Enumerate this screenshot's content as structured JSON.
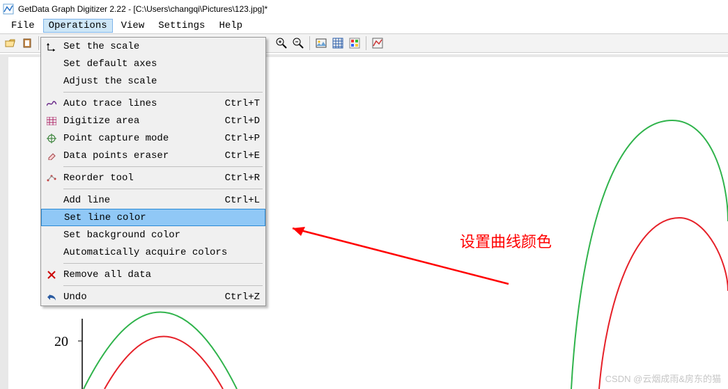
{
  "title": "GetData Graph Digitizer 2.22 - [C:\\Users\\changqi\\Pictures\\123.jpg]*",
  "menubar": {
    "file": "File",
    "operations": "Operations",
    "view": "View",
    "settings": "Settings",
    "help": "Help"
  },
  "dropdown": {
    "set_scale": "Set the scale",
    "set_default_axes": "Set default axes",
    "adjust_scale": "Adjust the scale",
    "auto_trace": "Auto trace lines",
    "auto_trace_sc": "Ctrl+T",
    "digitize_area": "Digitize area",
    "digitize_area_sc": "Ctrl+D",
    "point_capture": "Point capture mode",
    "point_capture_sc": "Ctrl+P",
    "data_eraser": "Data points eraser",
    "data_eraser_sc": "Ctrl+E",
    "reorder": "Reorder tool",
    "reorder_sc": "Ctrl+R",
    "add_line": "Add line",
    "add_line_sc": "Ctrl+L",
    "set_line_color": "Set line color",
    "set_bg_color": "Set background color",
    "auto_colors": "Automatically acquire colors",
    "remove_all": "Remove all data",
    "undo": "Undo",
    "undo_sc": "Ctrl+Z"
  },
  "axis_tick": "20",
  "annotation": "设置曲线颜色",
  "watermark": "CSDN @云烟成雨&房东的猫",
  "chart_data": {
    "type": "line",
    "title": "",
    "xlabel": "",
    "ylabel": "",
    "ylim": [
      0,
      100
    ],
    "series": [
      {
        "name": "green-curve",
        "color": "#2fb34b",
        "note": "sinusoidal, larger amplitude"
      },
      {
        "name": "red-curve",
        "color": "#e62129",
        "note": "sinusoidal, smaller amplitude"
      }
    ],
    "visible_y_ticks": [
      20
    ]
  }
}
